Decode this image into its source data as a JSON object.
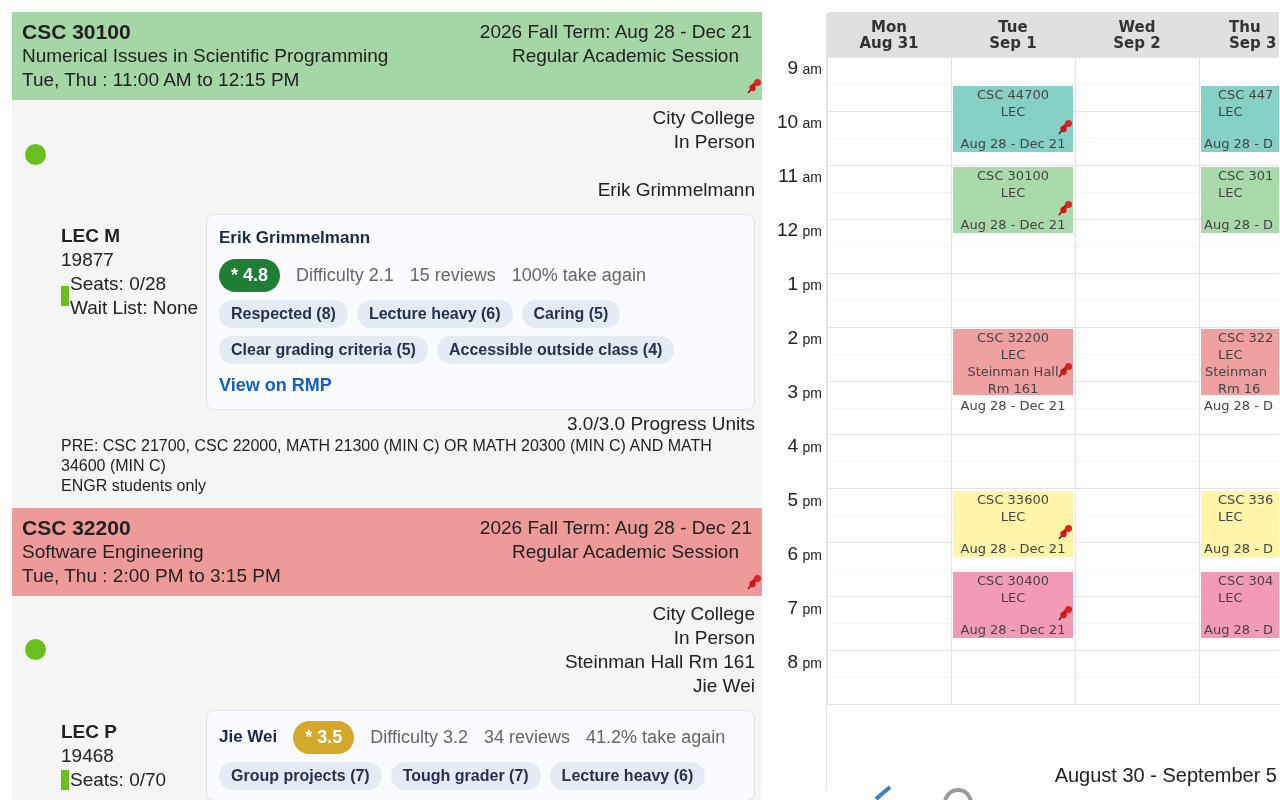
{
  "courses": [
    {
      "code": "CSC 30100",
      "title": "Numerical Issues in Scientific Programming",
      "schedule": "Tue, Thu : 11:00 AM to 12:15 PM",
      "term": "2026 Fall Term: Aug 28 - Dec 21",
      "session": "Regular Academic Session",
      "color": "#a5d6a7",
      "pinned": true,
      "campus": "City College",
      "mode": "In Person",
      "instructor": "Erik Grimmelmann",
      "section": {
        "label": "LEC M",
        "number": "19877",
        "seats": "Seats: 0/28",
        "waitlist": "Wait List: None"
      },
      "rmp": {
        "kind": "stacked",
        "name": "Erik Grimmelmann",
        "rating": "* 4.8",
        "color": "#1e7e34",
        "difficulty": "Difficulty 2.1",
        "reviews": "15 reviews",
        "take_again": "100% take again",
        "tags": [
          "Respected (8)",
          "Lecture heavy (6)",
          "Caring (5)",
          "Clear grading criteria (5)",
          "Accessible outside class (4)"
        ],
        "link": "View on RMP"
      },
      "units": "3.0/3.0 Progress Units",
      "notes": [
        "PRE: CSC 21700, CSC 22000, MATH 21300 (MIN C) OR MATH 20300 (MIN C) AND MATH 34600 (MIN C)",
        "ENGR students only"
      ]
    },
    {
      "code": "CSC 32200",
      "title": "Software Engineering",
      "schedule": "Tue, Thu : 2:00 PM to 3:15 PM",
      "term": "2026 Fall Term: Aug 28 - Dec 21",
      "session": "Regular Academic Session",
      "color": "#ef9a9a",
      "pinned": true,
      "campus": "City College",
      "mode": "In Person",
      "room": "Steinman Hall Rm 161",
      "instructor": "Jie Wei",
      "section": {
        "label": "LEC P",
        "number": "19468",
        "seats": "Seats: 0/70"
      },
      "rmp": {
        "kind": "inline",
        "name": "Jie Wei",
        "rating": "* 3.5",
        "color": "#d4a82a",
        "difficulty": "Difficulty 3.2",
        "reviews": "34 reviews",
        "take_again": "41.2% take again",
        "tags": [
          "Group projects (7)",
          "Tough grader (7)",
          "Lecture heavy (6)"
        ]
      }
    }
  ],
  "calendar": {
    "times": [
      {
        "hour": "9",
        "suffix": "am"
      },
      {
        "hour": "10",
        "suffix": "am"
      },
      {
        "hour": "11",
        "suffix": "am"
      },
      {
        "hour": "12",
        "suffix": "pm"
      },
      {
        "hour": "1",
        "suffix": "pm"
      },
      {
        "hour": "2",
        "suffix": "pm"
      },
      {
        "hour": "3",
        "suffix": "pm"
      },
      {
        "hour": "4",
        "suffix": "pm"
      },
      {
        "hour": "5",
        "suffix": "pm"
      },
      {
        "hour": "6",
        "suffix": "pm"
      },
      {
        "hour": "7",
        "suffix": "pm"
      },
      {
        "hour": "8",
        "suffix": "pm"
      }
    ],
    "days": [
      {
        "name": "Mon",
        "date": "Aug 31"
      },
      {
        "name": "Tue",
        "date": "Sep 1",
        "events": [
          {
            "lines": [
              "CSC 44700",
              "LEC"
            ],
            "dates": "Aug 28 - Dec 21",
            "color": "#86d0c6",
            "pinned": true
          },
          {
            "lines": [
              "CSC 30100",
              "LEC"
            ],
            "dates": "Aug 28 - Dec 21",
            "color": "#aad9ab",
            "pinned": true
          },
          {
            "lines": [
              "CSC 32200",
              "LEC",
              "Steinman Hall",
              "Rm 161"
            ],
            "dates": "Aug 28 - Dec 21",
            "color": "#efa1a1",
            "pinned": true
          },
          {
            "lines": [
              "CSC 33600",
              "LEC"
            ],
            "dates": "Aug 28 - Dec 21",
            "color": "#fff4a8",
            "pinned": true
          },
          {
            "lines": [
              "CSC 30400",
              "LEC"
            ],
            "dates": "Aug 28 - Dec 21",
            "color": "#f39ab8",
            "pinned": true
          }
        ]
      },
      {
        "name": "Wed",
        "date": "Sep 2"
      },
      {
        "name": "Thu",
        "date": "Sep 3",
        "events": [
          {
            "lines": [
              "CSC 447",
              "LEC"
            ],
            "dates": "Aug 28 - D",
            "color": "#86d0c6"
          },
          {
            "lines": [
              "CSC 301",
              "LEC"
            ],
            "dates": "Aug 28 - D",
            "color": "#aad9ab"
          },
          {
            "lines": [
              "CSC 322",
              "LEC",
              "Steinman",
              "Rm 16"
            ],
            "dates": "Aug 28 - D",
            "color": "#efa1a1"
          },
          {
            "lines": [
              "CSC 336",
              "LEC"
            ],
            "dates": "Aug 28 - D",
            "color": "#fff4a8"
          },
          {
            "lines": [
              "CSC 304",
              "LEC"
            ],
            "dates": "Aug 28 - D",
            "color": "#f39ab8"
          }
        ]
      }
    ],
    "range": "August 30 - September 5"
  }
}
